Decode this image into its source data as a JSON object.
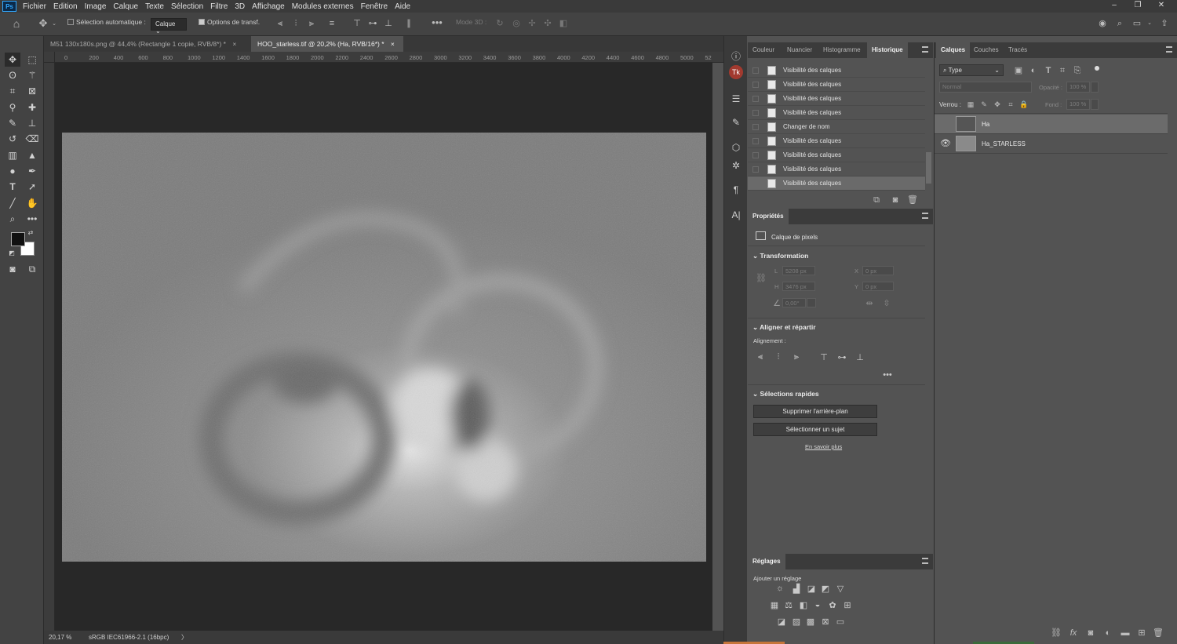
{
  "menu": [
    "Fichier",
    "Edition",
    "Image",
    "Calque",
    "Texte",
    "Sélection",
    "Filtre",
    "3D",
    "Affichage",
    "Modules externes",
    "Fenêtre",
    "Aide"
  ],
  "app_logo": "Ps",
  "options": {
    "auto_select_label": "Sélection automatique :",
    "auto_select_value": "Calque",
    "transform_label": "Options de transf.",
    "mode3d_label": "Mode 3D :"
  },
  "tabs": [
    {
      "label": "M51 130x180s.png @ 44,4% (Rectangle 1 copie, RVB/8*) *"
    },
    {
      "label": "HOO_starless.tif @ 20,2% (Ha, RVB/16*) *"
    }
  ],
  "ruler_ticks": [
    "0",
    "200",
    "400",
    "600",
    "800",
    "1000",
    "1200",
    "1400",
    "1600",
    "1800",
    "2000",
    "2200",
    "2400",
    "2600",
    "2800",
    "3000",
    "3200",
    "3400",
    "3600",
    "3800",
    "4000",
    "4200",
    "4400",
    "4600",
    "4800",
    "5000",
    "52"
  ],
  "status": {
    "zoom": "20,17 %",
    "profile": "sRGB IEC61966-2.1 (16bpc)"
  },
  "history_panel": {
    "tabs": [
      "Couleur",
      "Nuancier",
      "Histogramme",
      "Historique"
    ],
    "active_tab": "Historique",
    "items": [
      "Visibilité des calques",
      "Visibilité des calques",
      "Visibilité des calques",
      "Visibilité des calques",
      "Changer de nom",
      "Visibilité des calques",
      "Visibilité des calques",
      "Visibilité des calques",
      "Visibilité des calques"
    ]
  },
  "properties_panel": {
    "title": "Propriétés",
    "layer_type": "Calque de pixels",
    "transform_title": "Transformation",
    "w_label": "L",
    "w_value": "5208 px",
    "h_label": "H",
    "h_value": "3476 px",
    "x_label": "X",
    "x_value": "0 px",
    "y_label": "Y",
    "y_value": "0 px",
    "angle_value": "0,00°",
    "align_title": "Aligner et répartir",
    "align_label": "Alignement :",
    "quick_title": "Sélections rapides",
    "remove_bg": "Supprimer l'arrière-plan",
    "select_subject": "Sélectionner un sujet",
    "learn_more": "En savoir plus"
  },
  "adjustments_panel": {
    "title": "Réglages",
    "subtitle": "Ajouter un réglage"
  },
  "layers_panel": {
    "tabs": [
      "Calques",
      "Couches",
      "Tracés"
    ],
    "active_tab": "Calques",
    "filter": "Type",
    "blend_mode": "Normal",
    "opacity_label": "Opacité :",
    "opacity_value": "100 %",
    "lock_label": "Verrou :",
    "fill_label": "Fond :",
    "fill_value": "100 %",
    "layers": [
      {
        "name": "Ha",
        "visible": false,
        "selected": true
      },
      {
        "name": "Ha_STARLESS",
        "visible": true,
        "selected": false
      }
    ]
  }
}
